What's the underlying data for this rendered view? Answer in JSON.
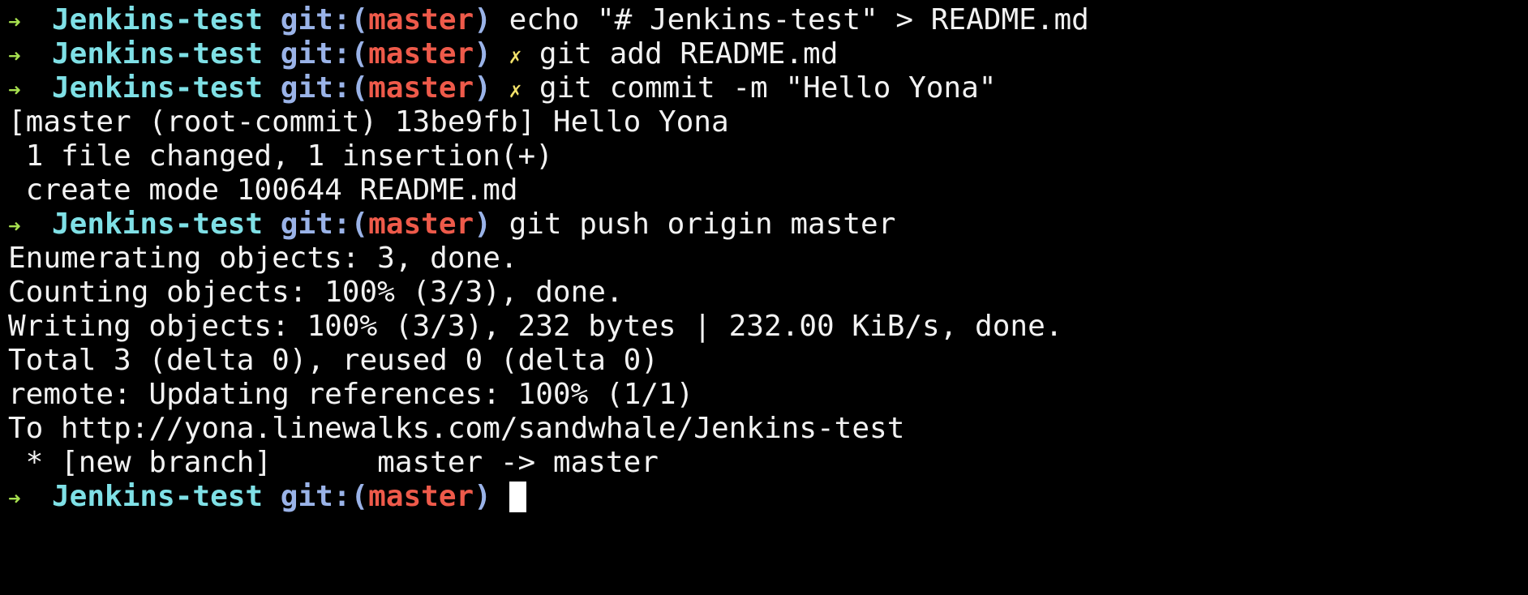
{
  "colors": {
    "background": "#000000",
    "arrow": "#a7e04f",
    "directory": "#7fe0e6",
    "git_label": "#9ab3e8",
    "branch": "#ee5a4a",
    "dirty_marker": "#f3e26a",
    "text": "#f2f2f2"
  },
  "prompt": {
    "arrow": "➜",
    "directory": "Jenkins-test",
    "git_label": "git:(",
    "branch": "master",
    "close_paren": ")",
    "dirty_marker": "✗"
  },
  "lines": [
    {
      "type": "prompt",
      "dirty": false,
      "command": "echo \"# Jenkins-test\" > README.md"
    },
    {
      "type": "prompt",
      "dirty": true,
      "command": "git add README.md"
    },
    {
      "type": "prompt",
      "dirty": true,
      "command": "git commit -m \"Hello Yona\""
    },
    {
      "type": "output",
      "text": "[master (root-commit) 13be9fb] Hello Yona"
    },
    {
      "type": "output",
      "text": " 1 file changed, 1 insertion(+)"
    },
    {
      "type": "output",
      "text": " create mode 100644 README.md"
    },
    {
      "type": "prompt",
      "dirty": false,
      "command": "git push origin master"
    },
    {
      "type": "output",
      "text": "Enumerating objects: 3, done."
    },
    {
      "type": "output",
      "text": "Counting objects: 100% (3/3), done."
    },
    {
      "type": "output",
      "text": "Writing objects: 100% (3/3), 232 bytes | 232.00 KiB/s, done."
    },
    {
      "type": "output",
      "text": "Total 3 (delta 0), reused 0 (delta 0)"
    },
    {
      "type": "output",
      "text": "remote: Updating references: 100% (1/1)"
    },
    {
      "type": "output",
      "text": "To http://yona.linewalks.com/sandwhale/Jenkins-test"
    },
    {
      "type": "output",
      "text": " * [new branch]      master -> master"
    },
    {
      "type": "prompt",
      "dirty": false,
      "command": "",
      "cursor": true
    }
  ]
}
